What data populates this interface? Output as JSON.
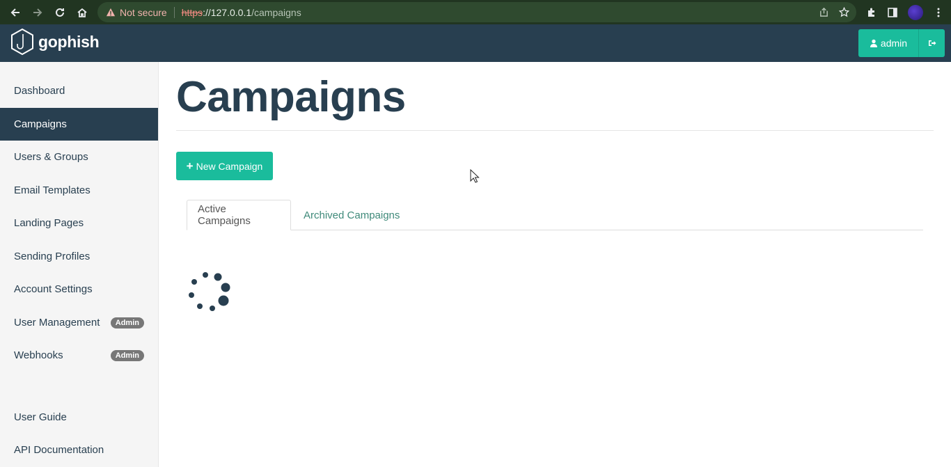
{
  "browser": {
    "security_label": "Not secure",
    "url_scheme": "https",
    "url_host": "://127.0.0.1",
    "url_path": "/campaigns"
  },
  "brand": {
    "name": "gophish"
  },
  "header": {
    "user_label": "admin"
  },
  "sidebar": {
    "items": [
      {
        "label": "Dashboard"
      },
      {
        "label": "Campaigns",
        "active": true
      },
      {
        "label": "Users & Groups"
      },
      {
        "label": "Email Templates"
      },
      {
        "label": "Landing Pages"
      },
      {
        "label": "Sending Profiles"
      },
      {
        "label": "Account Settings"
      },
      {
        "label": "User Management",
        "badge": "Admin"
      },
      {
        "label": "Webhooks",
        "badge": "Admin"
      }
    ],
    "footer_items": [
      {
        "label": "User Guide"
      },
      {
        "label": "API Documentation"
      }
    ]
  },
  "main": {
    "title": "Campaigns",
    "new_button_label": "New Campaign",
    "tabs": [
      {
        "label": "Active Campaigns",
        "active": true
      },
      {
        "label": "Archived Campaigns"
      }
    ]
  },
  "colors": {
    "navbar": "#283f50",
    "accent": "#1abc9c",
    "chrome": "#213521"
  }
}
